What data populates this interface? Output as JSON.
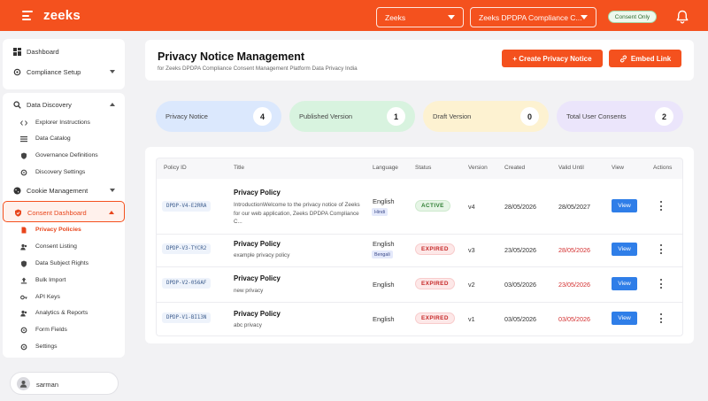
{
  "topbar": {
    "brand": "zeeks",
    "org_select": "Zeeks",
    "project_select": "Zeeks DPDPA Compliance C...",
    "mode_badge": "Consent Only"
  },
  "sidebar": {
    "dashboard": "Dashboard",
    "compliance_setup": "Compliance Setup",
    "data_discovery": "Data Discovery",
    "data_discovery_items": [
      "Explorer Instructions",
      "Data Catalog",
      "Governance Definitions",
      "Discovery Settings"
    ],
    "cookie_management": "Cookie Management",
    "consent_dashboard": "Consent Dashboard",
    "consent_items": [
      "Privacy Policies",
      "Consent Listing",
      "Data Subject Rights",
      "Bulk Import",
      "API Keys",
      "Analytics & Reports",
      "Form Fields",
      "Settings"
    ],
    "user_name": "sarman"
  },
  "header": {
    "title": "Privacy Notice Management",
    "subtitle": "for Zeeks DPDPA Compliance Consent Management Platform Data Privacy India",
    "create_btn": "+ Create Privacy Notice",
    "embed_btn": "Embed Link"
  },
  "stats": [
    {
      "label": "Privacy Notice",
      "value": "4",
      "color": "#dbe8fd"
    },
    {
      "label": "Published Version",
      "value": "1",
      "color": "#d8f3df"
    },
    {
      "label": "Draft Version",
      "value": "0",
      "color": "#fdf2d1"
    },
    {
      "label": "Total User Consents",
      "value": "2",
      "color": "#ebe5fb"
    }
  ],
  "table": {
    "columns": [
      "Policy ID",
      "Title",
      "Language",
      "Status",
      "Version",
      "Created",
      "Valid Until",
      "View",
      "Actions"
    ],
    "rows": [
      {
        "id": "DPDP-V4-E2RRA",
        "title": "Privacy Policy",
        "desc": "IntroductionWelcome to the privacy notice of Zeeks for our web application, Zeeks DPDPA Compliance C...",
        "language": "English",
        "lang_tag": "Hindi",
        "status": "ACTIVE",
        "version": "v4",
        "created": "28/05/2026",
        "valid_until": "28/05/2027",
        "view": "View"
      },
      {
        "id": "DPDP-V3-TYCR2",
        "title": "Privacy Policy",
        "desc": "example privacy policy",
        "language": "English",
        "lang_tag": "Bengali",
        "status": "EXPIRED",
        "version": "v3",
        "created": "23/05/2026",
        "valid_until": "28/05/2026",
        "view": "View"
      },
      {
        "id": "DPDP-V2-056AF",
        "title": "Privacy Policy",
        "desc": "new privacy",
        "language": "English",
        "lang_tag": "",
        "status": "EXPIRED",
        "version": "v2",
        "created": "03/05/2026",
        "valid_until": "23/05/2026",
        "view": "View"
      },
      {
        "id": "DPDP-V1-BI13N",
        "title": "Privacy Policy",
        "desc": "abc privacy",
        "language": "English",
        "lang_tag": "",
        "status": "EXPIRED",
        "version": "v1",
        "created": "03/05/2026",
        "valid_until": "03/05/2026",
        "view": "View"
      }
    ]
  },
  "colors": {
    "brand": "#f4511e",
    "view_button": "#2f7ee8",
    "active_green": "#2e7d32",
    "expired_red": "#c62828"
  }
}
